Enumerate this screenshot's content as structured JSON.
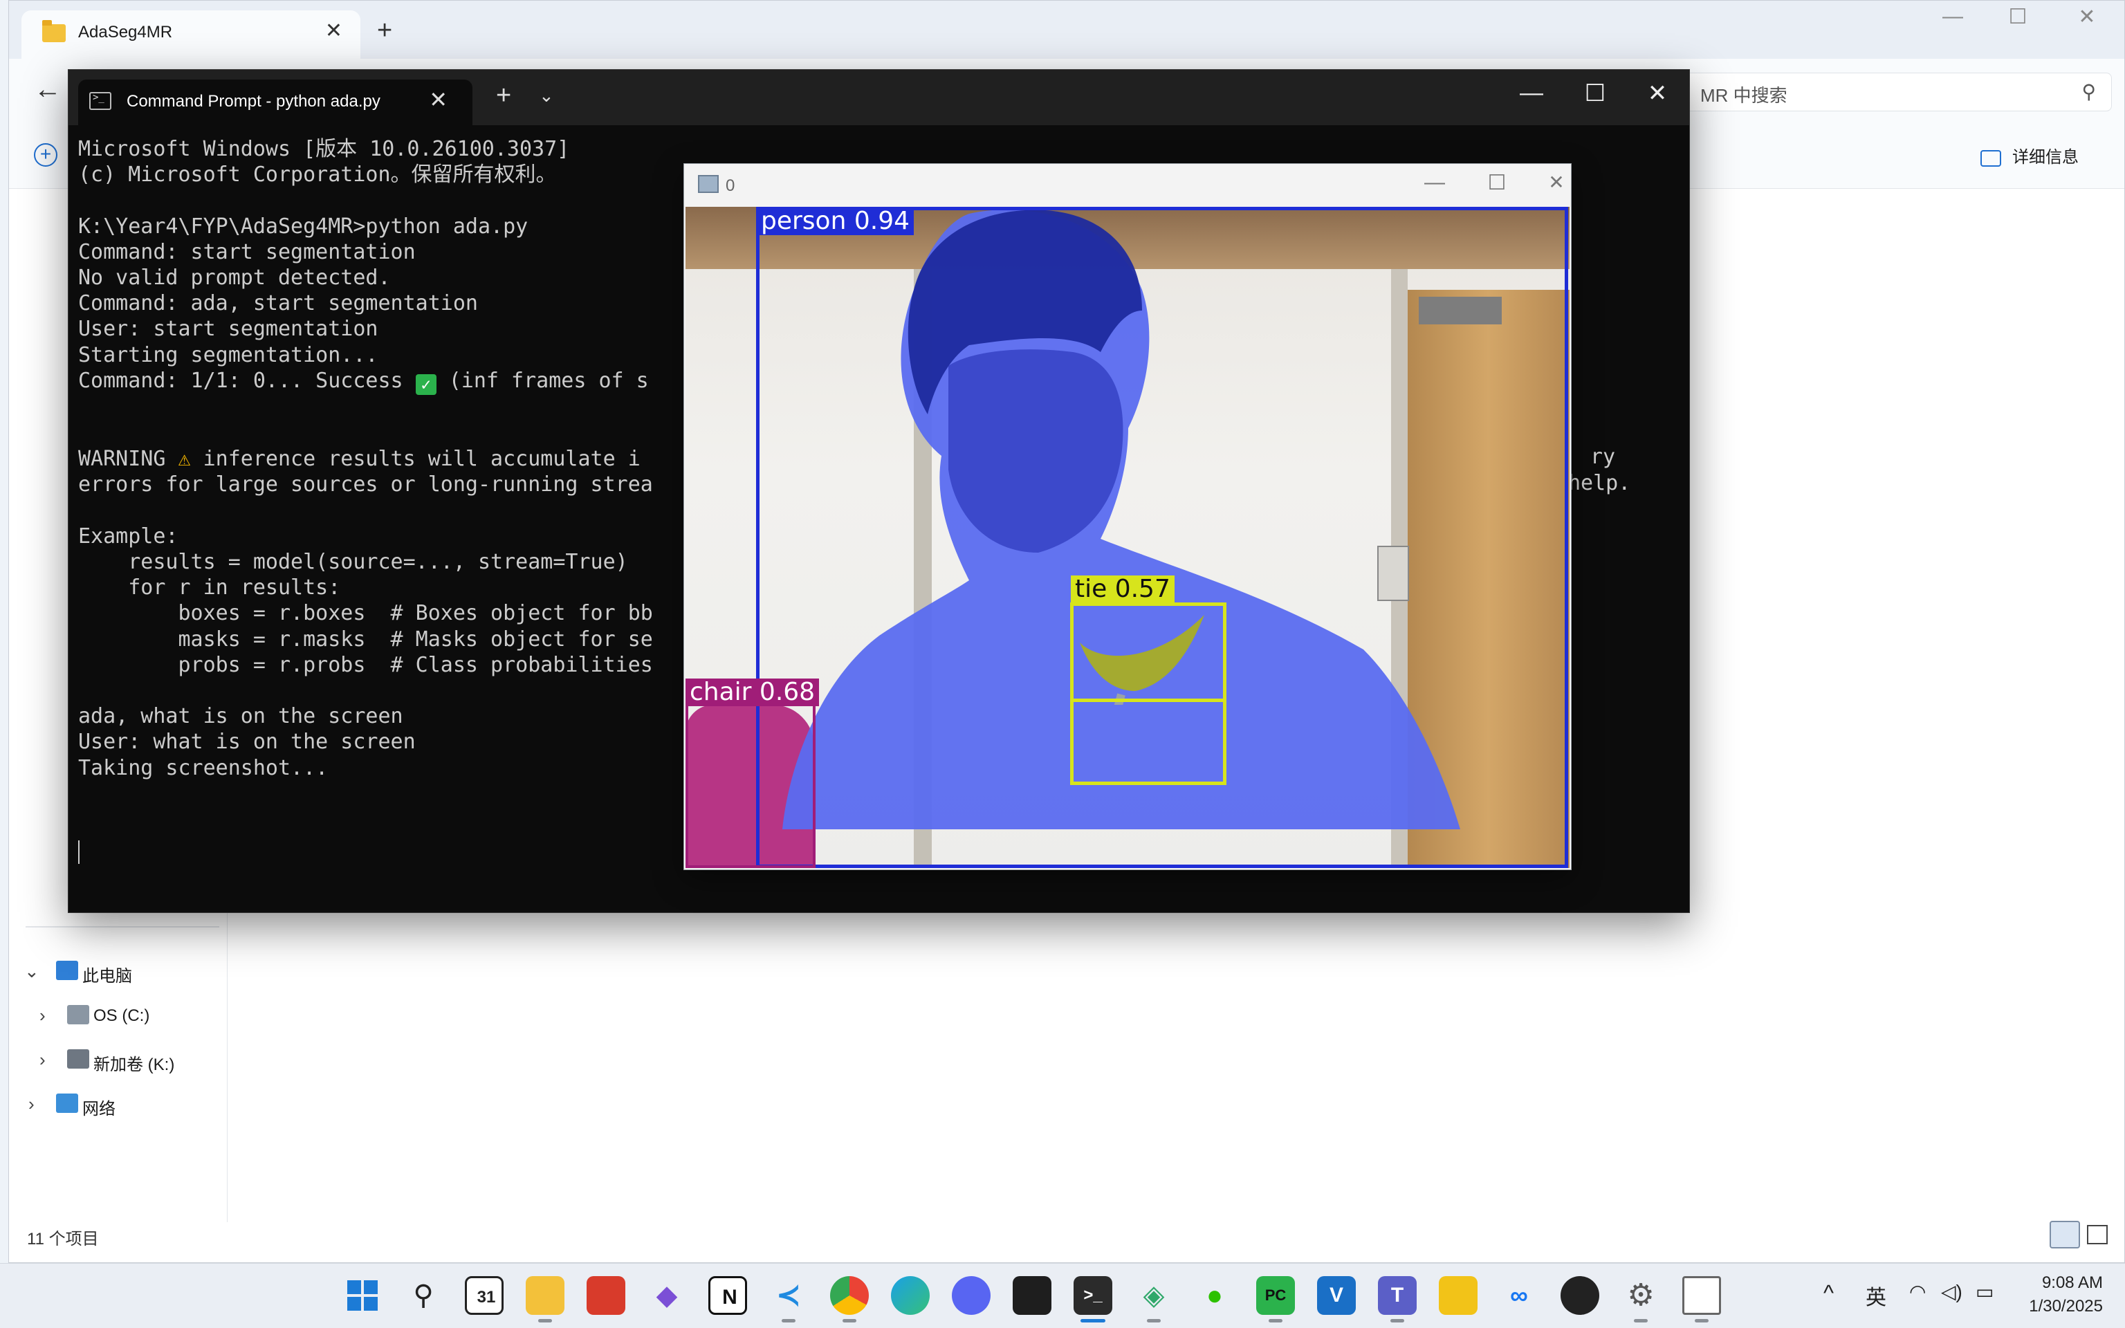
{
  "explorer": {
    "tab_title": "AdaSeg4MR",
    "search_placeholder": "MR 中搜索",
    "details_label": "详细信息",
    "status": "11 个项目",
    "nav": {
      "this_pc": "此电脑",
      "drive_c": "OS (C:)",
      "drive_k": "新加卷 (K:)",
      "network": "网络"
    }
  },
  "terminal": {
    "tab_title": "Command Prompt - python ada.py",
    "lines": [
      "Microsoft Windows [版本 10.0.26100.3037]",
      "(c) Microsoft Corporation。保留所有权利。",
      "",
      "K:\\Year4\\FYP\\AdaSeg4MR>python ada.py",
      "Command: start segmentation",
      "No valid prompt detected.",
      "Command: ada, start segmentation",
      "User: start segmentation",
      "Starting segmentation...",
      "Command: 1/1: 0... Success ",
      "",
      "",
      "WARNING ",
      "errors for large sources or long-running strea",
      "",
      "Example:",
      "    results = model(source=..., stream=True)",
      "    for r in results:",
      "        boxes = r.boxes  # Boxes object for bb",
      "        masks = r.masks  # Masks object for se",
      "        probs = r.probs  # Class probabilities",
      "",
      "ada, what is on the screen",
      "User: what is on the screen",
      "Taking screenshot..."
    ],
    "line9_tail": " (inf frames of s",
    "line12_tail": " inference results will accumulate i",
    "overflow_right_1": "ry",
    "overflow_right_2": "help."
  },
  "viewer": {
    "title": "0",
    "detections": [
      {
        "label": "person 0.94",
        "color": "#1f2dd6"
      },
      {
        "label": "tie 0.57",
        "color": "#d7e41c"
      },
      {
        "label": "chair 0.68",
        "color": "#a01d78"
      }
    ]
  },
  "taskbar": {
    "ime": "英",
    "time": "9:08 AM",
    "date": "1/30/2025",
    "apps": [
      "start",
      "search",
      "calendar",
      "file-explorer",
      "screen-recorder",
      "obsidian",
      "notion",
      "vscode",
      "chrome",
      "edge",
      "discord",
      "figma",
      "terminal",
      "git",
      "wechat",
      "pycharm",
      "vectorize",
      "teams",
      "puzzle",
      "meta",
      "obs",
      "settings",
      "notepad"
    ]
  }
}
